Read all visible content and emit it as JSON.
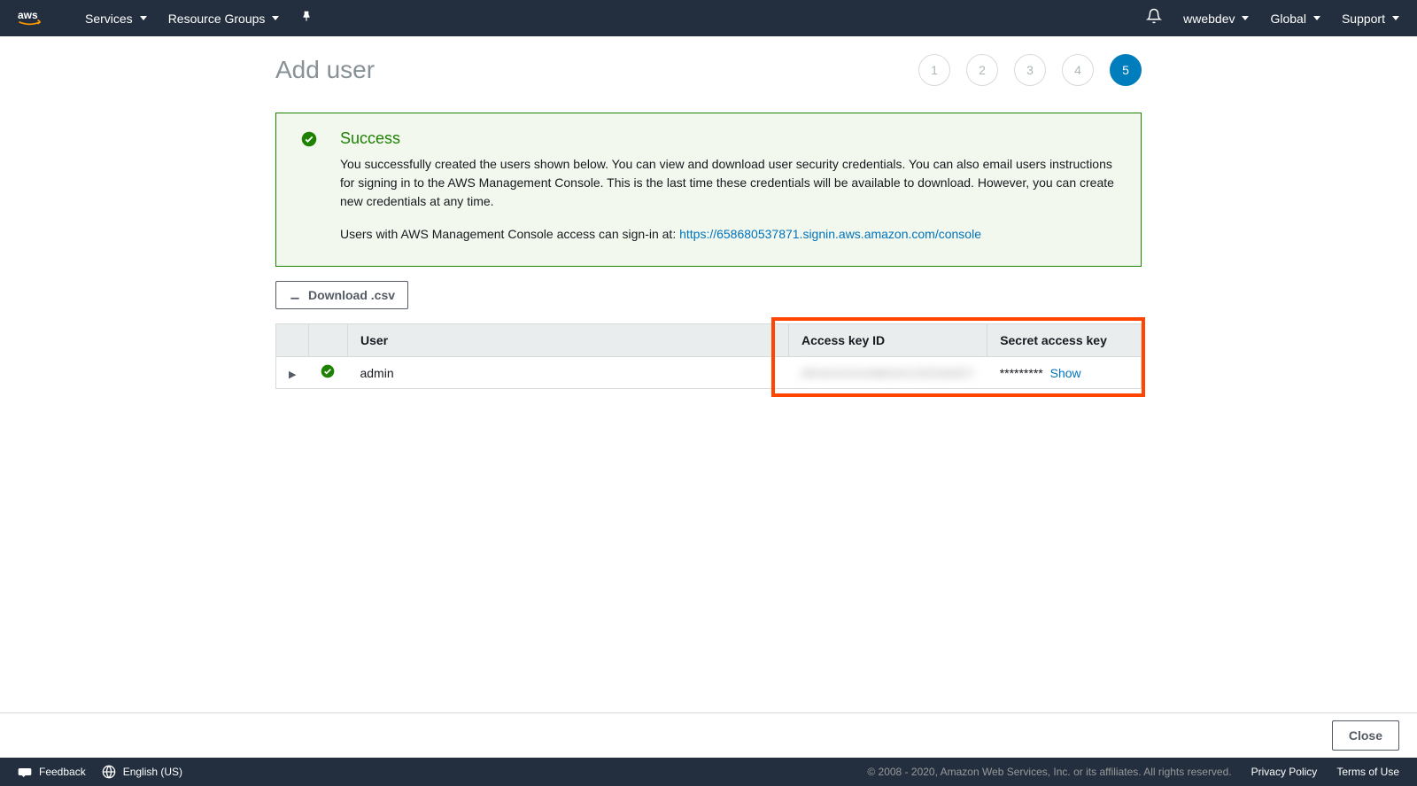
{
  "nav": {
    "services": "Services",
    "resourceGroups": "Resource Groups",
    "username": "wwebdev",
    "region": "Global",
    "support": "Support"
  },
  "page": {
    "title": "Add user"
  },
  "steps": [
    "1",
    "2",
    "3",
    "4",
    "5"
  ],
  "activeStep": 5,
  "success": {
    "title": "Success",
    "body": "You successfully created the users shown below. You can view and download user security credentials. You can also email users instructions for signing in to the AWS Management Console. This is the last time these credentials will be available to download. However, you can create new credentials at any time.",
    "signinPrefix": "Users with AWS Management Console access can sign-in at: ",
    "signinUrl": "https://658680537871.signin.aws.amazon.com/console"
  },
  "downloadLabel": "Download .csv",
  "table": {
    "headers": {
      "user": "User",
      "accessKey": "Access key ID",
      "secretKey": "Secret access key"
    },
    "row": {
      "user": "admin",
      "accessKeyMasked": "AKIAXXXXAWSACCESSKEY",
      "secretMask": "*********",
      "showLabel": "Show"
    }
  },
  "closeLabel": "Close",
  "footer": {
    "feedback": "Feedback",
    "language": "English (US)",
    "copyright": "© 2008 - 2020, Amazon Web Services, Inc. or its affiliates. All rights reserved.",
    "privacy": "Privacy Policy",
    "terms": "Terms of Use"
  }
}
